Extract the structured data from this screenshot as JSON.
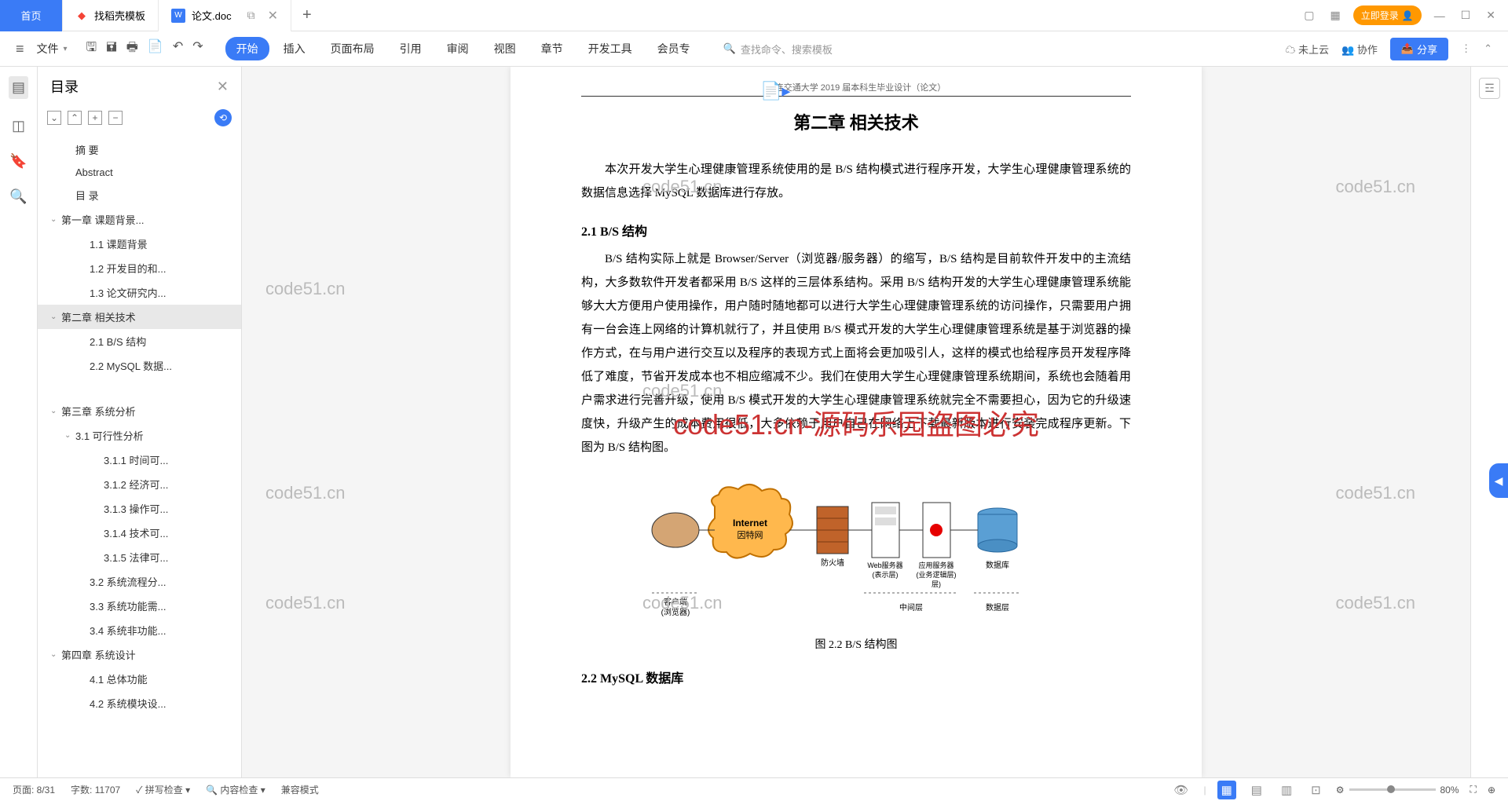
{
  "tabs": {
    "home": "首页",
    "t1": "找稻壳模板",
    "t2": "论文.doc",
    "add": "+"
  },
  "titleRight": {
    "login": "立即登录"
  },
  "toolbar": {
    "file": "文件",
    "ribbon": [
      "开始",
      "插入",
      "页面布局",
      "引用",
      "审阅",
      "视图",
      "章节",
      "开发工具",
      "会员专"
    ],
    "activeRibbon": 0,
    "searchPlaceholder": "查找命令、搜索模板",
    "cloud": "未上云",
    "coop": "协作",
    "share": "分享"
  },
  "outline": {
    "title": "目录",
    "items": [
      {
        "t": "摘    要",
        "lv": 1
      },
      {
        "t": "Abstract",
        "lv": 1
      },
      {
        "t": "目    录",
        "lv": 1
      },
      {
        "t": "第一章   课题背景...",
        "lv": 0,
        "exp": true
      },
      {
        "t": "1.1 课题背景",
        "lv": 2
      },
      {
        "t": "1.2 开发目的和...",
        "lv": 2
      },
      {
        "t": "1.3 论文研究内...",
        "lv": 2
      },
      {
        "t": "第二章  相关技术",
        "lv": 0,
        "exp": true,
        "sel": true
      },
      {
        "t": "2.1 B/S 结构",
        "lv": 2
      },
      {
        "t": "2.2 MySQL 数据...",
        "lv": 2
      },
      {
        "t": "",
        "lv": 0,
        "blank": true
      },
      {
        "t": "第三章  系统分析",
        "lv": 0,
        "exp": true
      },
      {
        "t": "3.1 可行性分析",
        "lv": 1,
        "exp": true
      },
      {
        "t": "3.1.1 时间可...",
        "lv": 3
      },
      {
        "t": "3.1.2 经济可...",
        "lv": 3
      },
      {
        "t": "3.1.3 操作可...",
        "lv": 3
      },
      {
        "t": "3.1.4 技术可...",
        "lv": 3
      },
      {
        "t": "3.1.5 法律可...",
        "lv": 3
      },
      {
        "t": "3.2 系统流程分...",
        "lv": 2
      },
      {
        "t": "3.3 系统功能需...",
        "lv": 2
      },
      {
        "t": "3.4 系统非功能...",
        "lv": 2
      },
      {
        "t": "第四章  系统设计",
        "lv": 0,
        "exp": true
      },
      {
        "t": "4.1 总体功能",
        "lv": 2
      },
      {
        "t": "4.2 系统模块设...",
        "lv": 2
      }
    ]
  },
  "doc": {
    "header": "大连交通大学 2019 届本科生毕业设计（论文）",
    "chapterTitle": "第二章  相关技术",
    "intro": "本次开发大学生心理健康管理系统使用的是 B/S 结构模式进行程序开发，大学生心理健康管理系统的数据信息选择 MySQL 数据库进行存放。",
    "s21_title": "2.1 B/S 结构",
    "s21_body": "B/S 结构实际上就是 Browser/Server（浏览器/服务器）的缩写，B/S 结构是目前软件开发中的主流结构，大多数软件开发者都采用 B/S 这样的三层体系结构。采用 B/S 结构开发的大学生心理健康管理系统能够大大方便用户使用操作，用户随时随地都可以进行大学生心理健康管理系统的访问操作，只需要用户拥有一台会连上网络的计算机就行了，并且使用 B/S 模式开发的大学生心理健康管理系统是基于浏览器的操作方式，在与用户进行交互以及程序的表现方式上面将会更加吸引人，这样的模式也给程序员开发程序降低了难度，节省开发成本也不相应缩减不少。我们在使用大学生心理健康管理系统期间，系统也会随着用户需求进行完善升级，使用 B/S 模式开发的大学生心理健康管理系统就完全不需要担心，因为它的升级速度快，升级产生的成本费用很低，大多依赖于用户自己在网络上下载最新版本进行安装完成程序更新。下图为 B/S 结构图。",
    "diagramLabels": {
      "internet": "Internet",
      "internet2": "因特网",
      "firewall": "防火墙",
      "web": "Web服务器",
      "web2": "(表示层)",
      "app": "应用服务器",
      "app2": "(业务逻辑层)",
      "db": "数据库",
      "client": "客户端",
      "client2": "(浏览器)",
      "mid": "中间层",
      "dblayer": "数据层"
    },
    "caption": "图 2.2 B/S 结构图",
    "s22_title": "2.2 MySQL 数据库",
    "watermark_big": "code51.cn-源码乐园盗图必究",
    "wm_small": "code51.cn"
  },
  "status": {
    "page": "页面: 8/31",
    "words": "字数: 11707",
    "spell": "拼写检查",
    "content": "内容检查",
    "compat": "兼容模式",
    "zoom": "80%"
  }
}
